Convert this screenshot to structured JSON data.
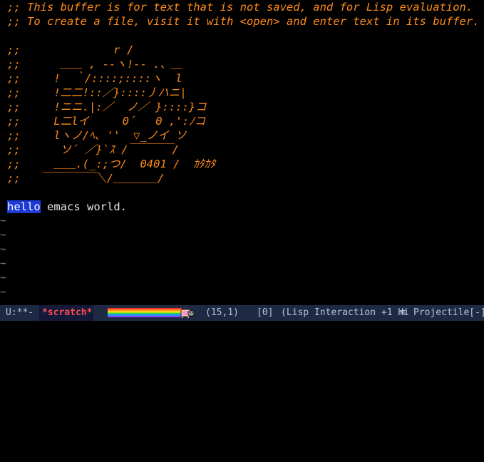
{
  "buffer": {
    "comment_lines": [
      ";; This buffer is for text that is not saved, and for Lisp evaluation.",
      ";; To create a file, visit it with <open> and enter text in its buffer."
    ],
    "art_lines": [
      ";;              r /",
      ";;      ＿＿ , --ヽ!-- .、＿",
      ";;     !  ｀/::::;::::ヽ  l",
      ";;     !二二!::／}::::丿ハニ|",
      ";;     !ニニ.|:／  ノ／ }::::}コ",
      ";;     L二lイ     0´   0 ,':ﾉコ",
      ";;     lヽノ/ﾍ､ ''  ▽_ノイ ソ",
      ";;      ソ´ ／}`ｽ /￣￣￣￣/",
      ";;     ＿＿.(_:;つ/  0401 /  ｶﾀｶﾀ",
      ";;   ￣￣￣￣￣＼/＿＿＿＿/"
    ],
    "selected_word": "hello",
    "rest_of_line": " emacs world.",
    "fringe_tilde": "~"
  },
  "modeline": {
    "state": "U:**-",
    "buffer_name": "*scratch*",
    "position": "(15,1)",
    "recursion": "[0]",
    "mode": "(Lisp Interaction +1 Hi",
    "menu_glyph": "≡",
    "projectile": "Projectile[-])"
  },
  "colors": {
    "background": "#000000",
    "comment": "#ff8c1a",
    "text": "#e6e6e6",
    "selection": "#1c3bd6",
    "modeline_bg": "#1e2a44",
    "buffer_name": "#ff4d4d"
  }
}
